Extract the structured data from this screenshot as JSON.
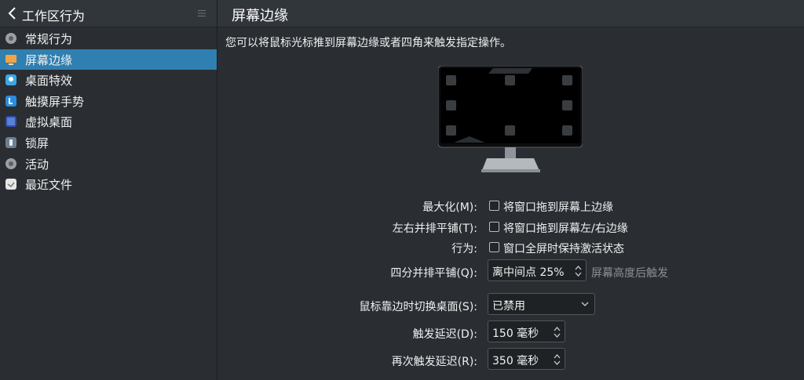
{
  "sidebar": {
    "title": "工作区行为",
    "items": [
      {
        "label": "常规行为",
        "icon": "general-behavior-icon"
      },
      {
        "label": "屏幕边缘",
        "icon": "screen-edges-icon"
      },
      {
        "label": "桌面特效",
        "icon": "desktop-effects-icon"
      },
      {
        "label": "触摸屏手势",
        "icon": "touchscreen-gestures-icon"
      },
      {
        "label": "虚拟桌面",
        "icon": "virtual-desktops-icon"
      },
      {
        "label": "锁屏",
        "icon": "screen-lock-icon"
      },
      {
        "label": "活动",
        "icon": "activities-icon"
      },
      {
        "label": "最近文件",
        "icon": "recent-files-icon"
      }
    ],
    "active_index": 1
  },
  "main": {
    "title": "屏幕边缘",
    "description": "您可以将鼠标光标推到屏幕边缘或者四角来触发指定操作。",
    "maximize_label": "最大化(M):",
    "maximize_check": "将窗口拖到屏幕上边缘",
    "tile_label": "左右并排平铺(T):",
    "tile_check": "将窗口拖到屏幕左/右边缘",
    "behavior_label": "行为:",
    "behavior_check": "窗口全屏时保持激活状态",
    "quarter_label": "四分并排平铺(Q):",
    "quarter_value": "离中间点 25%",
    "quarter_suffix": "屏幕高度后触发",
    "switch_label": "鼠标靠边时切换桌面(S):",
    "switch_value": "已禁用",
    "delay_label": "触发延迟(D):",
    "delay_value": "150 毫秒",
    "retrigger_label": "再次触发延迟(R):",
    "retrigger_value": "350 毫秒"
  },
  "colors": {
    "background": "#2a2e32",
    "header": "#31363b",
    "selection": "#2f7fb0",
    "text": "#eff0f1"
  }
}
